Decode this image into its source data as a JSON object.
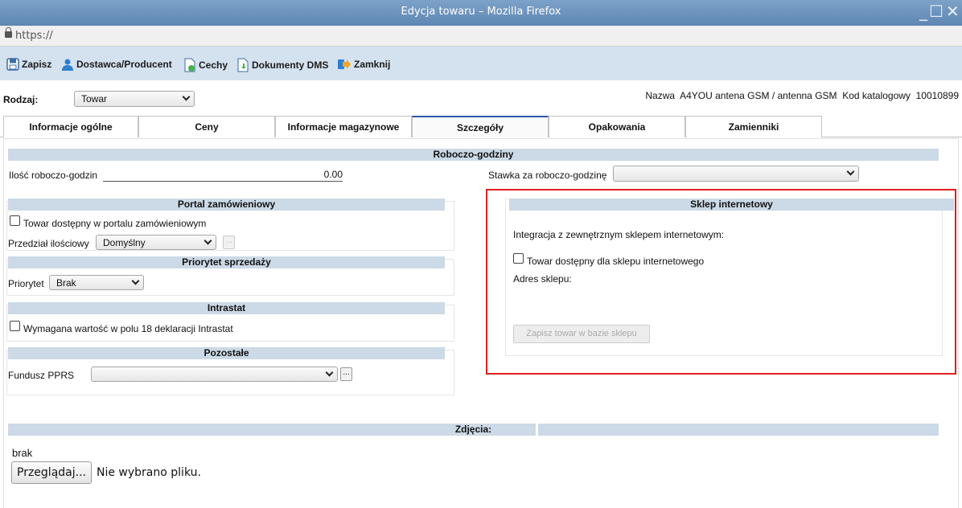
{
  "window": {
    "title": "Edycja towaru – Mozilla Firefox"
  },
  "browser": {
    "url": "https://"
  },
  "toolbar": {
    "save": "Zapisz",
    "supplier": "Dostawca/Producent",
    "features": "Cechy",
    "documents": "Dokumenty DMS",
    "close": "Zamknij"
  },
  "header": {
    "rodzaj_label": "Rodzaj:",
    "rodzaj_value": "Towar",
    "nazwa_label": "Nazwa",
    "nazwa_value": "A4YOU antena GSM / antenna GSM",
    "kod_label": "Kod katalogowy",
    "kod_value": "10010899"
  },
  "tabs": [
    {
      "label": "Informacje ogólne"
    },
    {
      "label": "Ceny"
    },
    {
      "label": "Informacje magazynowe"
    },
    {
      "label": "Szczegóły",
      "active": true
    },
    {
      "label": "Opakowania"
    },
    {
      "label": "Zamienniki"
    }
  ],
  "roboczo": {
    "title": "Roboczo-godziny",
    "ilosc_label": "Ilość roboczo-godzin",
    "ilosc_value": "0.00",
    "stawka_label": "Stawka za roboczo-godzinę",
    "stawka_value": ""
  },
  "portal": {
    "title": "Portal zamówieniowy",
    "checkbox_label": "Towar dostępny w portalu zamówieniowym",
    "przedzial_label": "Przedział ilościowy",
    "przedzial_value": "Domyślny",
    "dots": "..."
  },
  "priorytet": {
    "title": "Priorytet sprzedaży",
    "label": "Priorytet",
    "value": "Brak"
  },
  "intrastat": {
    "title": "Intrastat",
    "checkbox_label": "Wymagana wartość w polu 18 deklaracji Intrastat"
  },
  "pozostale": {
    "title": "Pozostałe",
    "fundusz_label": "Fundusz PPRS",
    "fundusz_value": "",
    "dots": "..."
  },
  "sklep": {
    "title": "Sklep internetowy",
    "integration_text": "Integracja z zewnętrznym sklepem internetowym:",
    "checkbox_label": "Towar dostępny dla sklepu internetowego",
    "adres_label": "Adres sklepu:",
    "save_button": "Zapisz towar w bazie sklepu"
  },
  "zdjecia": {
    "title": "Zdjęcia:",
    "value": "brak",
    "browse_button": "Przeglądaj...",
    "no_file": "Nie wybrano pliku."
  },
  "colors": {
    "highlight": "#e01f1f",
    "section_bar": "#ccd9e6",
    "toolbar_bg": "#d4e1ef"
  }
}
